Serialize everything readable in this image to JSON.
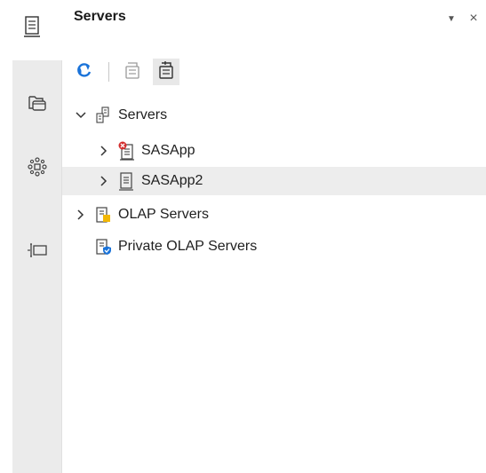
{
  "panel": {
    "title": "Servers",
    "menu_glyph": "▼",
    "close_glyph": "×"
  },
  "rail": {
    "top_icon": "server-icon",
    "items": [
      {
        "icon": "folders-icon"
      },
      {
        "icon": "network-node-icon"
      },
      {
        "icon": "text-cursor-box-icon"
      }
    ]
  },
  "toolbar": {
    "refresh_icon": "refresh-icon",
    "disconnect_icon": "server-disconnect-icon",
    "connect_icon": "server-connect-icon"
  },
  "tree": {
    "root": {
      "label": "Servers",
      "expanded": true,
      "icon": "server-group-icon"
    },
    "items": [
      {
        "label": "SASApp",
        "icon": "server-error-icon",
        "expanded": false
      },
      {
        "label": "SASApp2",
        "icon": "server-icon",
        "expanded": false,
        "selected": true
      }
    ],
    "olap": {
      "label": "OLAP Servers",
      "icon": "olap-server-icon",
      "expanded": false
    },
    "private_olap": {
      "label": "Private OLAP Servers",
      "icon": "private-olap-server-icon"
    }
  },
  "colors": {
    "accent_blue": "#1a73d9",
    "error_red": "#d32f2f",
    "olap_yellow": "#f2b705"
  }
}
